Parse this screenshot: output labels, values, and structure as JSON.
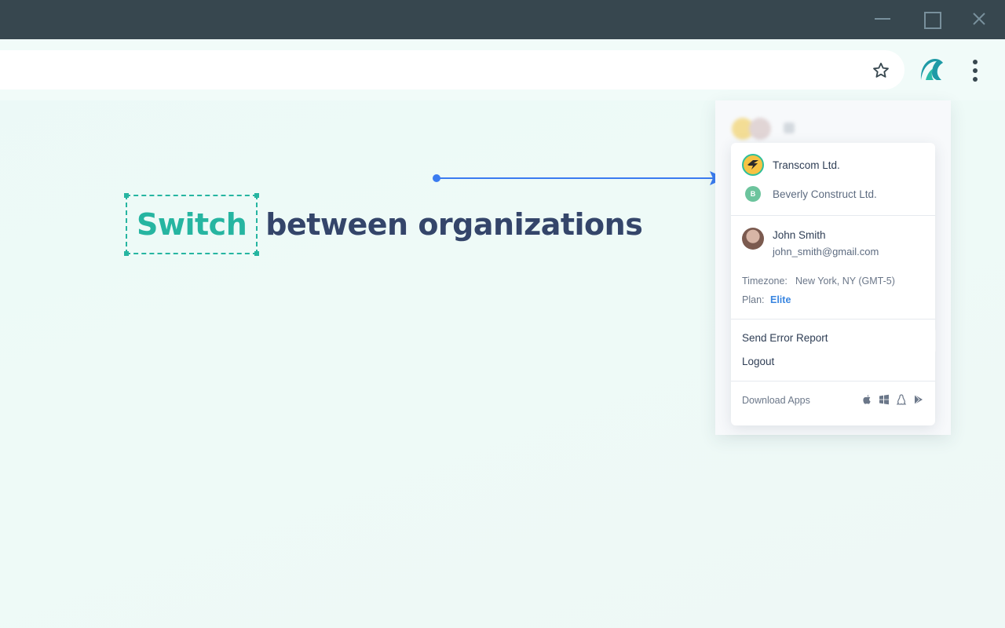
{
  "headline": {
    "highlight": "Switch",
    "rest": "between organizations"
  },
  "colors": {
    "accent": "#26b5a1",
    "headline_text": "#34456a",
    "arrow": "#3a7bf0",
    "plan": "#3a86e0"
  },
  "dropdown": {
    "organizations": [
      {
        "name": "Transcom Ltd.",
        "icon": "transcom-logo-icon",
        "active": true
      },
      {
        "name": "Beverly Construct Ltd.",
        "initial": "B",
        "active": false
      }
    ],
    "user": {
      "name": "John Smith",
      "email": "john_smith@gmail.com"
    },
    "timezone_label": "Timezone:",
    "timezone_value": "New York, NY (GMT-5)",
    "plan_label": "Plan:",
    "plan_value": "Elite",
    "menu": {
      "send_error_report": "Send Error Report",
      "logout": "Logout"
    },
    "download_label": "Download Apps",
    "download_icons": [
      "apple-icon",
      "windows-icon",
      "linux-icon",
      "google-play-icon"
    ]
  }
}
